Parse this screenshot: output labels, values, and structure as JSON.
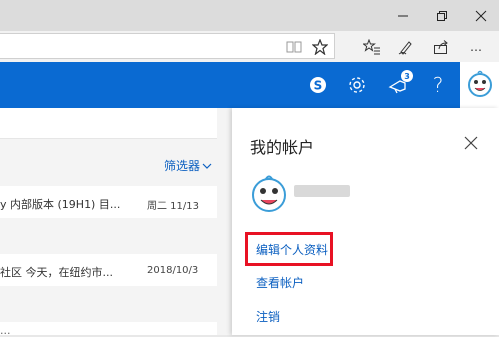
{
  "window": {
    "controls": {
      "minimize_icon": "minimize-icon",
      "restore_icon": "restore-icon",
      "close_icon": "close-icon"
    }
  },
  "browser": {
    "address_value": "",
    "icons": [
      "reading-view-icon",
      "favorite-star-icon",
      "favorites-hub-icon",
      "pen-notes-icon",
      "share-icon"
    ]
  },
  "header": {
    "accent_color": "#0a6ad2",
    "icons": [
      "skype-icon",
      "settings-gear-icon",
      "megaphone-icon",
      "help-icon"
    ],
    "notification_count": "3",
    "help_glyph": "?"
  },
  "mail_list": {
    "filter_label": "筛选器",
    "rows": [
      {
        "snippet": "y 内部版本 (19H1) 目...",
        "date": "周二 11/13"
      },
      {
        "snippet": "社区 今天，在纽约市...",
        "date": "2018/10/3"
      },
      {
        "snippet": "...",
        "date": ""
      }
    ]
  },
  "account_panel": {
    "title": "我的帐户",
    "links": {
      "edit_profile": "编辑个人资料",
      "view_account": "查看帐户",
      "sign_out": "注销"
    },
    "highlight_color": "#e81123"
  }
}
